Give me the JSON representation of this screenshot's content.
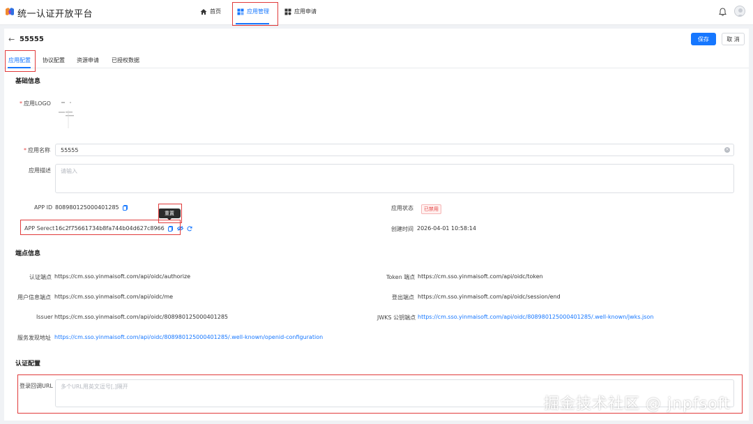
{
  "header": {
    "brand": "统一认证开放平台",
    "nav": [
      {
        "label": "首页",
        "icon": "home-icon"
      },
      {
        "label": "应用管理",
        "icon": "apps-icon",
        "active": true
      },
      {
        "label": "应用申请",
        "icon": "apply-icon"
      }
    ],
    "accent": "#1677ff",
    "highlight_color": "#e03a3a"
  },
  "page": {
    "app_title": "55555",
    "save_label": "保存",
    "cancel_label": "取 消"
  },
  "tabs": [
    {
      "label": "应用配置",
      "active": true
    },
    {
      "label": "协议配置"
    },
    {
      "label": "资源申请"
    },
    {
      "label": "已授权数据"
    }
  ],
  "basic": {
    "section_title": "基础信息",
    "logo_label": "应用LOGO",
    "name_label": "应用名称",
    "name_value": "55555",
    "desc_label": "应用描述",
    "desc_placeholder": "请输入",
    "app_id_label": "APP ID",
    "app_id_value": "808980125000401285",
    "app_status_label": "应用状态",
    "app_status_value": "已禁用",
    "secret_label": "APP Serect",
    "secret_value": "16c2f75661734b8fa744b04d627c8966",
    "created_label": "创建时间",
    "created_value": "2026-04-01 10:58:14",
    "reset_tooltip": "重置"
  },
  "endpoints": {
    "section_title": "端点信息",
    "auth_label": "认证端点",
    "auth_value": "https://cm.sso.yinmaisoft.com/api/oidc/authorize",
    "token_label": "Token 端点",
    "token_value": "https://cm.sso.yinmaisoft.com/api/oidc/token",
    "userinfo_label": "用户信息端点",
    "userinfo_value": "https://cm.sso.yinmaisoft.com/api/oidc/me",
    "logout_label": "登出端点",
    "logout_value": "https://cm.sso.yinmaisoft.com/api/oidc/session/end",
    "issuer_label": "Issuer",
    "issuer_value": "https://cm.sso.yinmaisoft.com/api/oidc/808980125000401285",
    "jwks_label": "JWKS 公钥端点",
    "jwks_value": "https://cm.sso.yinmaisoft.com/api/oidc/808980125000401285/.well-known/jwks.json",
    "discovery_label": "服务发现地址",
    "discovery_value": "https://cm.sso.yinmaisoft.com/api/oidc/808980125000401285/.well-known/openid-configuration"
  },
  "auth_config": {
    "section_title": "认证配置",
    "callback_label": "登录回调URL",
    "callback_placeholder": "多个URL用英文逗号[,]隔开"
  },
  "watermark": "掘金技术社区 @ jnpfsoft"
}
